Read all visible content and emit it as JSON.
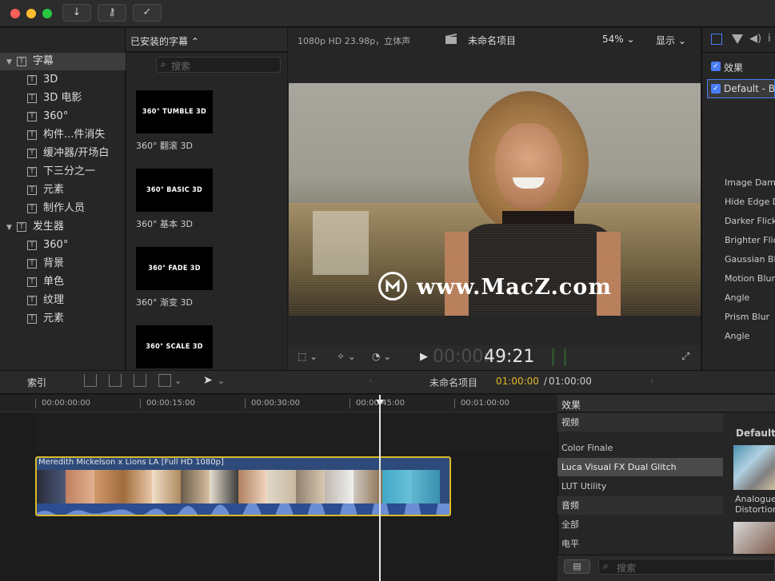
{
  "toolbar": {
    "import_icon": "↓",
    "keywords_icon": "⚷",
    "check_icon": "✓"
  },
  "library": {
    "header_title": "已安装的字幕 ⌃",
    "items": [
      {
        "label": "字幕",
        "level": 0,
        "expanded": true,
        "selected": true
      },
      {
        "label": "3D",
        "level": 1
      },
      {
        "label": "3D 电影",
        "level": 1
      },
      {
        "label": "360°",
        "level": 1
      },
      {
        "label": "构件...件消失",
        "level": 1
      },
      {
        "label": "缓冲器/开场白",
        "level": 1
      },
      {
        "label": "下三分之一",
        "level": 1
      },
      {
        "label": "元素",
        "level": 1
      },
      {
        "label": "制作人员",
        "level": 1
      },
      {
        "label": "发生器",
        "level": 0,
        "expanded": true
      },
      {
        "label": "360°",
        "level": 1
      },
      {
        "label": "背景",
        "level": 1
      },
      {
        "label": "单色",
        "level": 1
      },
      {
        "label": "纹理",
        "level": 1
      },
      {
        "label": "元素",
        "level": 1
      }
    ]
  },
  "browser": {
    "search_placeholder": "搜索",
    "thumbs": [
      {
        "title": "360° TUMBLE 3D",
        "label": "360° 翻滚 3D"
      },
      {
        "title": "360° BASIC 3D",
        "label": "360° 基本 3D"
      },
      {
        "title": "360° FADE 3D",
        "label": "360° 渐变 3D"
      },
      {
        "title": "360° SCALE 3D",
        "label": ""
      }
    ]
  },
  "viewer": {
    "format": "1080p HD 23.98p，立体声",
    "project": "未命名项目",
    "zoom": "54% ⌄",
    "display": "显示 ⌄",
    "watermark": "www.MacZ.com",
    "timecode_dim": "00:00:",
    "timecode": "49:21"
  },
  "inspector": {
    "effects_label": "效果",
    "default_label": "Default - Bu",
    "params": [
      "Image Dam",
      "Hide Edge D",
      "Darker Flick",
      "Brighter Flic",
      "Gaussian Bl",
      "Motion Blur",
      "Angle",
      "Prism Blur",
      "Angle"
    ]
  },
  "timeline_bar": {
    "index": "索引",
    "project": "未命名项目",
    "time_current": "01:00:00",
    "time_sep": " / ",
    "time_total": "01:00:00"
  },
  "ruler": [
    "00:00:00:00",
    "00:00:15:00",
    "00:00:30:00",
    "00:00:45:00",
    "00:01:00:00"
  ],
  "clip": {
    "title": "Meredith Mickelson x Lions LA [Full HD 1080p]"
  },
  "effects": {
    "header": "效果",
    "rows": [
      {
        "label": "视频",
        "type": "cat"
      },
      {
        "label": "Color Finale",
        "type": "item"
      },
      {
        "label": "Luca Visual FX Dual Glitch",
        "type": "item",
        "selected": true
      },
      {
        "label": "LUT Utility",
        "type": "item"
      },
      {
        "label": "音频",
        "type": "cat"
      },
      {
        "label": "全部",
        "type": "item"
      },
      {
        "label": "电平",
        "type": "item"
      }
    ],
    "preview_title": "Default",
    "preview_caption": "Analogue Distortion",
    "search_placeholder": "搜索"
  },
  "colors": {
    "accent": "#4a7cf6",
    "clip_border": "#d9b92c",
    "playhead": "#e8e8e8",
    "timecode_yellow": "#e6b82a"
  }
}
